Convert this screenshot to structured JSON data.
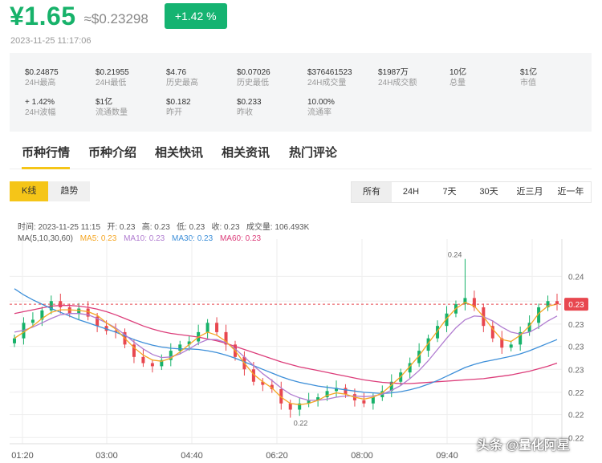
{
  "header": {
    "price": "¥1.65",
    "approx_usd": "≈$0.23298",
    "change_badge": "+1.42 %",
    "timestamp": "2023-11-25 11:17:06"
  },
  "stats": [
    {
      "value": "$0.24875",
      "label": "24H最高"
    },
    {
      "value": "$0.21955",
      "label": "24H最低"
    },
    {
      "value": "$4.76",
      "label": "历史最高"
    },
    {
      "value": "$0.07026",
      "label": "历史最低"
    },
    {
      "value": "$376461523",
      "label": "24H成交量"
    },
    {
      "value": "$1987万",
      "label": "24H成交额"
    },
    {
      "value": "10亿",
      "label": "总量"
    },
    {
      "value": "$1亿",
      "label": "市值"
    },
    {
      "value": "+ 1.42%",
      "label": "24H波幅"
    },
    {
      "value": "$1亿",
      "label": "流通数量"
    },
    {
      "value": "$0.182",
      "label": "昨开"
    },
    {
      "value": "$0.233",
      "label": "昨收"
    },
    {
      "value": "10.00%",
      "label": "流通率"
    }
  ],
  "tabs": [
    "币种行情",
    "币种介绍",
    "相关快讯",
    "相关资讯",
    "热门评论"
  ],
  "chart_mode": [
    "K线",
    "趋势"
  ],
  "ranges": [
    "所有",
    "24H",
    "7天",
    "30天",
    "近三月",
    "近一年"
  ],
  "ohlc_info": {
    "time": "时间: 2023-11-25 11:15",
    "open": "开: 0.23",
    "high": "高: 0.23",
    "low": "低: 0.23",
    "close": "收: 0.23",
    "volume": "成交量: 106.493K"
  },
  "ma_info": {
    "label": "MA(5,10,30,60)",
    "ma5": "MA5: 0.23",
    "ma10": "MA10: 0.23",
    "ma30": "MA30: 0.23",
    "ma60": "MA60: 0.23"
  },
  "colors": {
    "up": "#17b26a",
    "down": "#e8474f",
    "ma5": "#f5a623",
    "ma10": "#b07cd0",
    "ma30": "#3d8fd9",
    "ma60": "#dc3d7a",
    "accent": "#f5c518"
  },
  "chart_data": {
    "type": "candlestick",
    "x_ticks": [
      "01:20",
      "03:00",
      "04:40",
      "06:20",
      "08:00",
      "09:40"
    ],
    "y_ticks": [
      "0.24",
      "0.23",
      "0.23",
      "0.23",
      "0.23",
      "0.22",
      "0.22",
      "0.22"
    ],
    "y_values": [
      0.242,
      0.238,
      0.2343,
      0.2307,
      0.227,
      0.2233,
      0.2197,
      0.216
    ],
    "current_price_label": "0.23",
    "current_price": 0.2375,
    "high_annotation": "0.24",
    "high_value": 0.2448,
    "low_annotation": "0.22",
    "low_value": 0.2192,
    "ylim": [
      0.215,
      0.248
    ],
    "closes": [
      0.232,
      0.2345,
      0.235,
      0.2365,
      0.238,
      0.237,
      0.236,
      0.2368,
      0.2355,
      0.234,
      0.2332,
      0.233,
      0.231,
      0.229,
      0.228,
      0.2275,
      0.2285,
      0.23,
      0.231,
      0.2315,
      0.233,
      0.2345,
      0.233,
      0.231,
      0.229,
      0.227,
      0.225,
      0.2245,
      0.2238,
      0.2215,
      0.2205,
      0.2215,
      0.222,
      0.2225,
      0.2235,
      0.224,
      0.223,
      0.222,
      0.2215,
      0.2225,
      0.2235,
      0.225,
      0.2265,
      0.228,
      0.23,
      0.232,
      0.234,
      0.236,
      0.2375,
      0.2385,
      0.237,
      0.234,
      0.232,
      0.2305,
      0.231,
      0.233,
      0.2345,
      0.237,
      0.238,
      0.2375
    ],
    "ma5": [
      0.232,
      0.233,
      0.234,
      0.2352,
      0.2362,
      0.2366,
      0.2366,
      0.2365,
      0.2363,
      0.2357,
      0.2345,
      0.2335,
      0.232,
      0.2305,
      0.2293,
      0.2285,
      0.2283,
      0.2288,
      0.2298,
      0.231,
      0.2322,
      0.233,
      0.2325,
      0.2315,
      0.23,
      0.228,
      0.2262,
      0.225,
      0.224,
      0.2225,
      0.2215,
      0.2213,
      0.2215,
      0.222,
      0.2228,
      0.2232,
      0.223,
      0.2225,
      0.2222,
      0.2225,
      0.2232,
      0.2245,
      0.2258,
      0.2275,
      0.2292,
      0.2312,
      0.2332,
      0.2352,
      0.2368,
      0.2378,
      0.2372,
      0.2355,
      0.2335,
      0.2318,
      0.2315,
      0.2325,
      0.234,
      0.236,
      0.2372,
      0.2375
    ],
    "ma10": [
      0.233,
      0.2333,
      0.2338,
      0.2345,
      0.2352,
      0.2358,
      0.236,
      0.236,
      0.2358,
      0.2352,
      0.2345,
      0.2337,
      0.2326,
      0.2314,
      0.2303,
      0.2294,
      0.2289,
      0.229,
      0.2295,
      0.2303,
      0.2312,
      0.2318,
      0.2318,
      0.2313,
      0.2303,
      0.229,
      0.2276,
      0.2263,
      0.2252,
      0.224,
      0.223,
      0.2224,
      0.222,
      0.222,
      0.2222,
      0.2225,
      0.2227,
      0.2227,
      0.2226,
      0.2227,
      0.223,
      0.2236,
      0.2244,
      0.2255,
      0.2268,
      0.2284,
      0.2302,
      0.232,
      0.2337,
      0.235,
      0.2356,
      0.2355,
      0.2348,
      0.2338,
      0.233,
      0.2327,
      0.233,
      0.2338,
      0.2348,
      0.2356
    ],
    "ma30": [
      0.24,
      0.239,
      0.2382,
      0.2375,
      0.2368,
      0.2362,
      0.2356,
      0.235,
      0.2345,
      0.234,
      0.2335,
      0.233,
      0.2324,
      0.2318,
      0.2313,
      0.2309,
      0.2306,
      0.2304,
      0.2303,
      0.2303,
      0.2302,
      0.23,
      0.2297,
      0.2293,
      0.2288,
      0.2282,
      0.2276,
      0.227,
      0.2264,
      0.2258,
      0.2253,
      0.2249,
      0.2246,
      0.2243,
      0.2241,
      0.2239,
      0.2237,
      0.2235,
      0.2233,
      0.2232,
      0.2231,
      0.2232,
      0.2234,
      0.2237,
      0.2241,
      0.2246,
      0.2252,
      0.2259,
      0.2266,
      0.2273,
      0.2278,
      0.2282,
      0.2285,
      0.2288,
      0.2291,
      0.2295,
      0.23,
      0.2306,
      0.2312,
      0.2318
    ],
    "ma60": [
      0.236,
      0.2363,
      0.2366,
      0.2369,
      0.2372,
      0.2373,
      0.2373,
      0.2372,
      0.237,
      0.2367,
      0.2363,
      0.2358,
      0.2352,
      0.2346,
      0.234,
      0.2335,
      0.2331,
      0.2328,
      0.2326,
      0.2324,
      0.2322,
      0.2319,
      0.2316,
      0.2312,
      0.2307,
      0.2302,
      0.2297,
      0.2292,
      0.2287,
      0.2282,
      0.2278,
      0.2274,
      0.2271,
      0.2268,
      0.2265,
      0.2262,
      0.2259,
      0.2256,
      0.2253,
      0.2251,
      0.2249,
      0.2248,
      0.2247,
      0.2247,
      0.2248,
      0.2249,
      0.225,
      0.2251,
      0.2252,
      0.2253,
      0.2254,
      0.2255,
      0.2257,
      0.2259,
      0.2261,
      0.2264,
      0.2267,
      0.2271,
      0.2275,
      0.228
    ],
    "grid": true,
    "legend": "top-left"
  }
}
